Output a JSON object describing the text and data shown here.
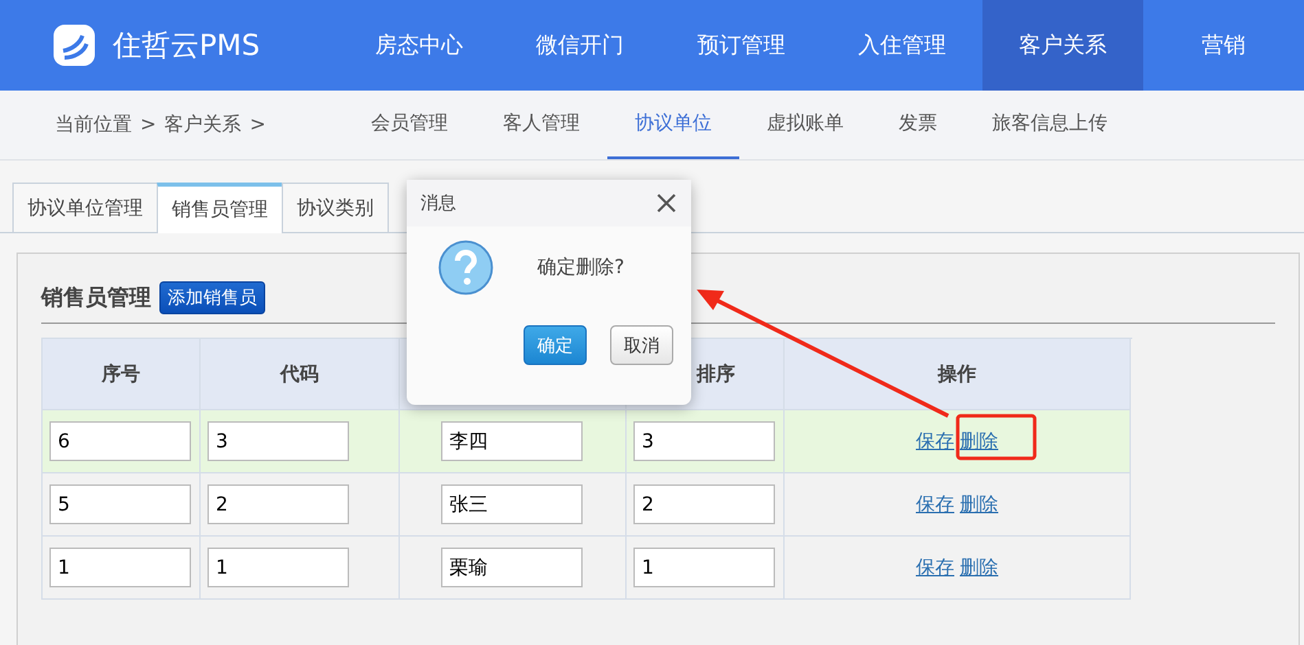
{
  "brand": {
    "name": "住哲云PMS"
  },
  "top_nav": [
    {
      "label": "房态中心",
      "selected": false
    },
    {
      "label": "微信开门",
      "selected": false
    },
    {
      "label": "预订管理",
      "selected": false
    },
    {
      "label": "入住管理",
      "selected": false
    },
    {
      "label": "客户关系",
      "selected": true
    },
    {
      "label": "营销",
      "selected": false
    }
  ],
  "breadcrumb": [
    "当前位置",
    ">",
    "客户关系",
    ">"
  ],
  "sub_nav": [
    {
      "label": "会员管理",
      "selected": false
    },
    {
      "label": "客人管理",
      "selected": false
    },
    {
      "label": "协议单位",
      "selected": true
    },
    {
      "label": "虚拟账单",
      "selected": false
    },
    {
      "label": "发票",
      "selected": false
    },
    {
      "label": "旅客信息上传",
      "selected": false
    }
  ],
  "tabs": [
    {
      "label": "协议单位管理",
      "selected": false
    },
    {
      "label": "销售员管理",
      "selected": true
    },
    {
      "label": "协议类别",
      "selected": false
    }
  ],
  "section": {
    "title": "销售员管理",
    "add_button": "添加销售员"
  },
  "table": {
    "columns": [
      "序号",
      "代码",
      "排序",
      "操作"
    ],
    "rows": [
      {
        "seq": "6",
        "code": "3",
        "name": "李四",
        "sort": "3",
        "actions": [
          "保存",
          "删除"
        ],
        "selected": true
      },
      {
        "seq": "5",
        "code": "2",
        "name": "张三",
        "sort": "2",
        "actions": [
          "保存",
          "删除"
        ],
        "selected": false
      },
      {
        "seq": "1",
        "code": "1",
        "name": "栗瑜",
        "sort": "1",
        "actions": [
          "保存",
          "删除"
        ],
        "selected": false
      }
    ]
  },
  "dialog": {
    "title": "消息",
    "message": "确定删除?",
    "buttons": [
      {
        "label": "确定",
        "kind": "primary"
      },
      {
        "label": "取消",
        "kind": "secondary"
      }
    ]
  }
}
